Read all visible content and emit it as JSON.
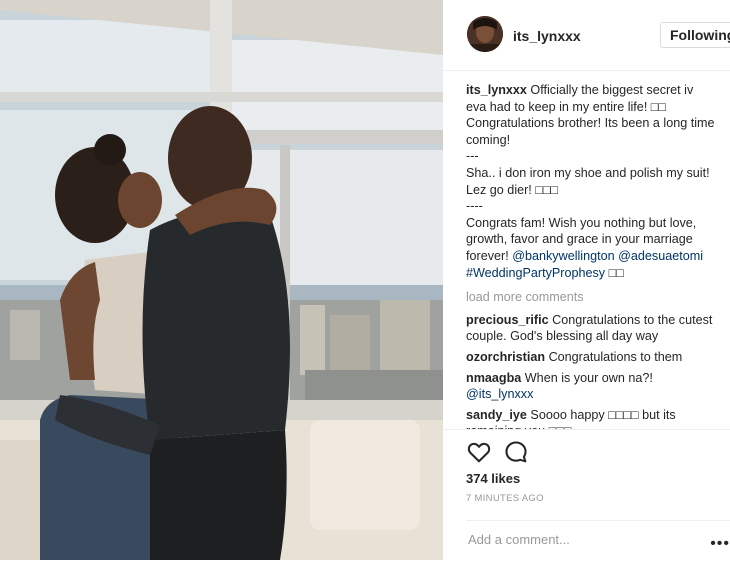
{
  "post": {
    "username": "its_lynxxx",
    "follow_label": "Following",
    "photo_alt": "Couple embracing by a window"
  },
  "caption": {
    "username": "its_lynxxx",
    "text_1": "Officially the biggest secret iv eva had to keep in my entire life! □□ Congratulations brother! Its been a long time coming!",
    "sep_1": "---",
    "text_2": "Sha.. i don iron my shoe and polish my suit! Lez go dier! □□□",
    "sep_2": "----",
    "text_3": "Congrats fam! Wish you nothing but love, growth, favor and grace in your marriage forever!",
    "mention_1": "@bankywellington",
    "mention_2": "@adesuaetomi",
    "hashtag": "#WeddingPartyProphesy",
    "hashtag_tail": "□□"
  },
  "load_more": "load more comments",
  "comments": [
    {
      "user": "precious_rific",
      "text": "Congratulations to the cutest couple. God's blessing all day way"
    },
    {
      "user": "ozorchristian",
      "text": "Congratulations to them"
    },
    {
      "user": "nmaagba",
      "text": "When is your own na?!",
      "mention": "@its_lynxxx"
    },
    {
      "user": "sandy_iye",
      "text": "Soooo happy □□□□ but its remaining you □□□"
    }
  ],
  "actions": {
    "like_icon": "heart-icon",
    "comment_icon": "comment-bubble-icon",
    "likes": "374 likes",
    "time": "7 MINUTES AGO",
    "add_comment_placeholder": "Add a comment...",
    "more_icon": "ellipsis-icon"
  },
  "colors": {
    "link": "#003569",
    "muted": "#999999",
    "text": "#262626",
    "border": "#efefef"
  }
}
